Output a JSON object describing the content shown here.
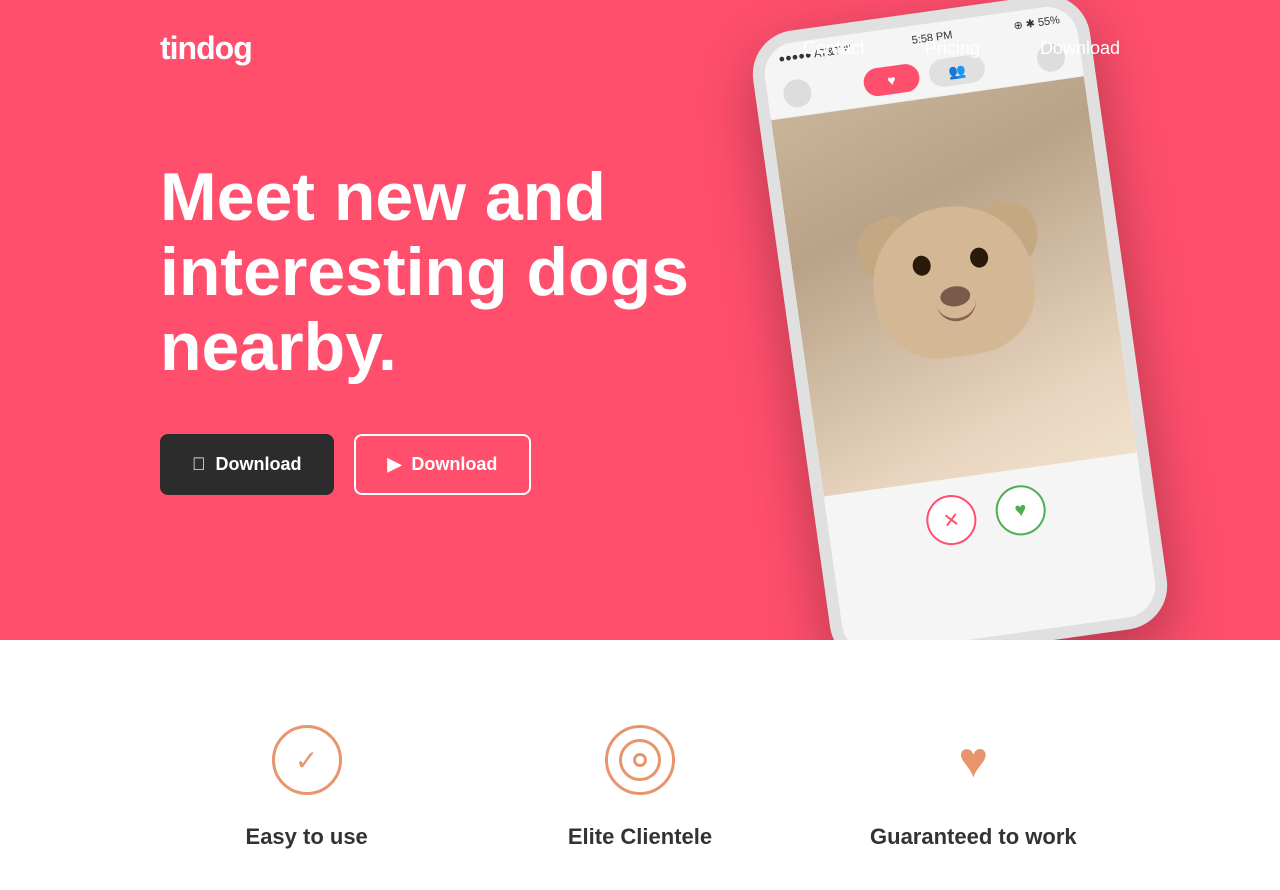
{
  "brand": {
    "logo": "tindog"
  },
  "navbar": {
    "links": [
      {
        "label": "Contact",
        "id": "contact"
      },
      {
        "label": "Pricing",
        "id": "pricing"
      },
      {
        "label": "Download",
        "id": "download"
      }
    ]
  },
  "hero": {
    "headline": "Meet new and interesting dogs nearby.",
    "buttons": {
      "apple": {
        "label": "Download",
        "icon": "apple-icon"
      },
      "google": {
        "label": "Download",
        "icon": "play-icon"
      }
    },
    "bg_color": "#ff4f6d"
  },
  "phone": {
    "status_left": "●●●●● AT&T ᵂ",
    "status_time": "5:58 PM",
    "status_right": "⊕ ✱ 55%"
  },
  "features": [
    {
      "icon": "check-icon",
      "title": "Easy to use"
    },
    {
      "icon": "target-icon",
      "title": "Elite Clientele"
    },
    {
      "icon": "heart-icon",
      "title": "Guaranteed to work"
    }
  ]
}
